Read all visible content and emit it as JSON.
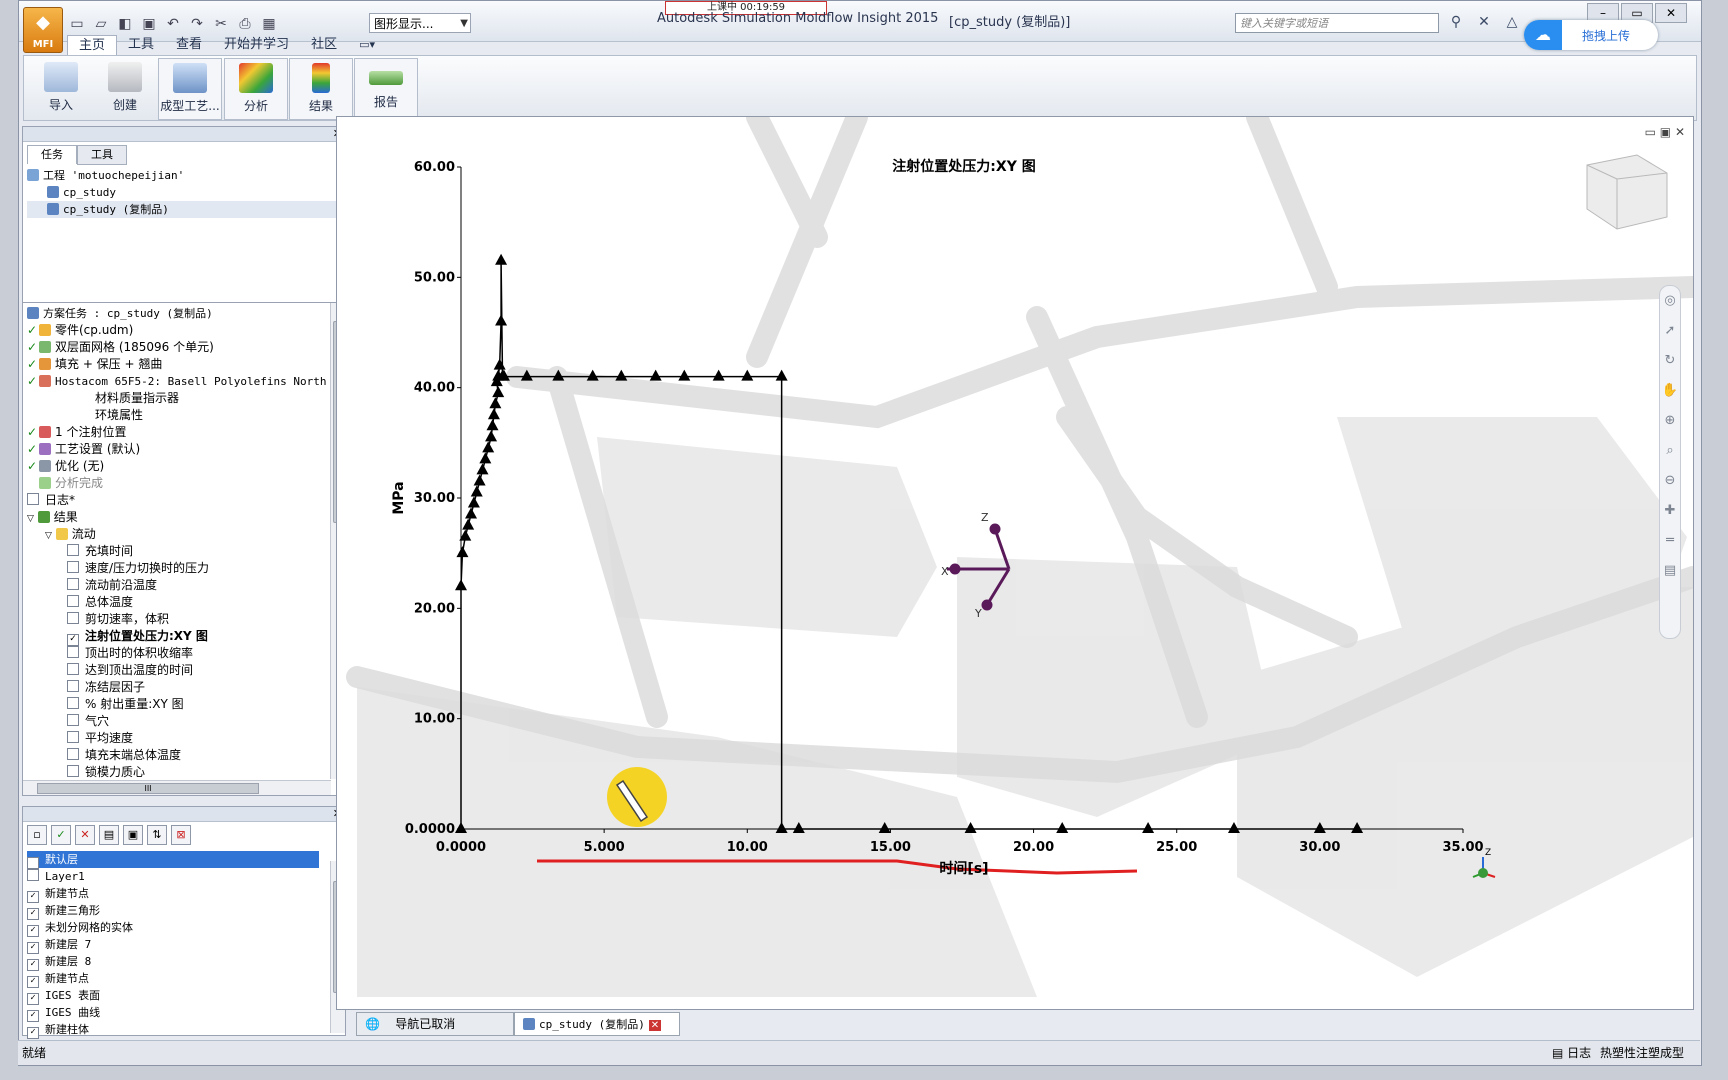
{
  "titlebar": {
    "app_title": "Autodesk Simulation Moldflow Insight 2015",
    "doc_title": "[cp_study (复制品)]",
    "recording": "上课中 00:19:59",
    "display_select": "图形显示...",
    "search_placeholder": "键入关键字或短语",
    "app_badge": "MFI",
    "upload_label": "拖拽上传"
  },
  "ribbon_tabs": [
    "主页",
    "工具",
    "查看",
    "开始并学习",
    "社区"
  ],
  "ribbon_buttons": [
    "导入",
    "创建",
    "成型工艺...",
    "分析",
    "结果",
    "报告"
  ],
  "panel_tabs": [
    "任务",
    "工具"
  ],
  "project": {
    "label": "工程 'motuochepeijian'",
    "items": [
      "cp_study",
      "cp_study (复制品)"
    ]
  },
  "study_tree": {
    "header": "方案任务 : cp_study (复制品)",
    "items": [
      "零件(cp.udm)",
      "双层面网格 (185096 个单元)",
      "填充 + 保压 + 翘曲",
      "Hostacom 65F5-2: Basell Polyolefins North",
      "材料质量指示器",
      "环境属性",
      "1 个注射位置",
      "工艺设置 (默认)",
      "优化 (无)",
      "分析完成",
      "日志*",
      "结果",
      "流动"
    ],
    "results": [
      "充填时间",
      "速度/压力切换时的压力",
      "流动前沿温度",
      "总体温度",
      "剪切速率，体积",
      "注射位置处压力:XY 图",
      "顶出时的体积收缩率",
      "达到顶出温度的时间",
      "冻结层因子",
      "% 射出重量:XY 图",
      "气穴",
      "平均速度",
      "填充末端总体温度",
      "锁模力质心"
    ],
    "scroll_mark": "III"
  },
  "layers": [
    "默认层",
    "Layer1",
    "新建节点",
    "新建三角形",
    "未划分网格的实体",
    "新建层 7",
    "新建层 8",
    "新建节点",
    "IGES 表面",
    "IGES 曲线",
    "新建柱体"
  ],
  "bottom_tabs": [
    "导航已取消",
    "cp_study (复制品)"
  ],
  "status": {
    "left": "就绪",
    "log": "日志",
    "right": "热塑性注塑成型"
  },
  "chart_data": {
    "type": "line",
    "title": "注射位置处压力:XY 图",
    "xlabel": "时间[s]",
    "ylabel": "MPa",
    "xlim": [
      0,
      35
    ],
    "ylim": [
      0,
      60
    ],
    "x_ticks": [
      "0.0000",
      "5.000",
      "10.00",
      "15.00",
      "20.00",
      "25.00",
      "30.00",
      "35.00"
    ],
    "y_ticks": [
      "0.0000",
      "10.00",
      "20.00",
      "30.00",
      "40.00",
      "50.00",
      "60.00"
    ],
    "grid": false,
    "series": [
      {
        "x": [
          0.0,
          0.0,
          0.05,
          0.15,
          0.25,
          0.35,
          0.45,
          0.55,
          0.65,
          0.75,
          0.85,
          0.95,
          1.05,
          1.1,
          1.15,
          1.2,
          1.3,
          1.25,
          1.3,
          1.35,
          1.4,
          1.4,
          1.45,
          1.5,
          2.3,
          3.4,
          4.6,
          5.6,
          6.8,
          7.8,
          9.0,
          10.0,
          11.2,
          11.2,
          11.8,
          14.8,
          17.8,
          21.0,
          24.0,
          27.0,
          30.0,
          31.3
        ],
        "y": [
          0.0,
          22.0,
          25.0,
          26.5,
          27.5,
          28.5,
          29.5,
          30.5,
          31.5,
          32.5,
          33.5,
          34.5,
          35.5,
          36.5,
          37.5,
          38.5,
          39.5,
          40.5,
          41.0,
          42.0,
          46.0,
          51.5,
          41.0,
          41.0,
          41.0,
          41.0,
          41.0,
          41.0,
          41.0,
          41.0,
          41.0,
          41.0,
          41.0,
          0.0,
          0.0,
          0.0,
          0.0,
          0.0,
          0.0,
          0.0,
          0.0,
          0.0
        ]
      }
    ],
    "marker": "triangle",
    "color": "#000000"
  },
  "colors": {
    "underline": "#e02020",
    "cursor_highlight": "#f4d21a",
    "triad": "#5a1a5a"
  }
}
